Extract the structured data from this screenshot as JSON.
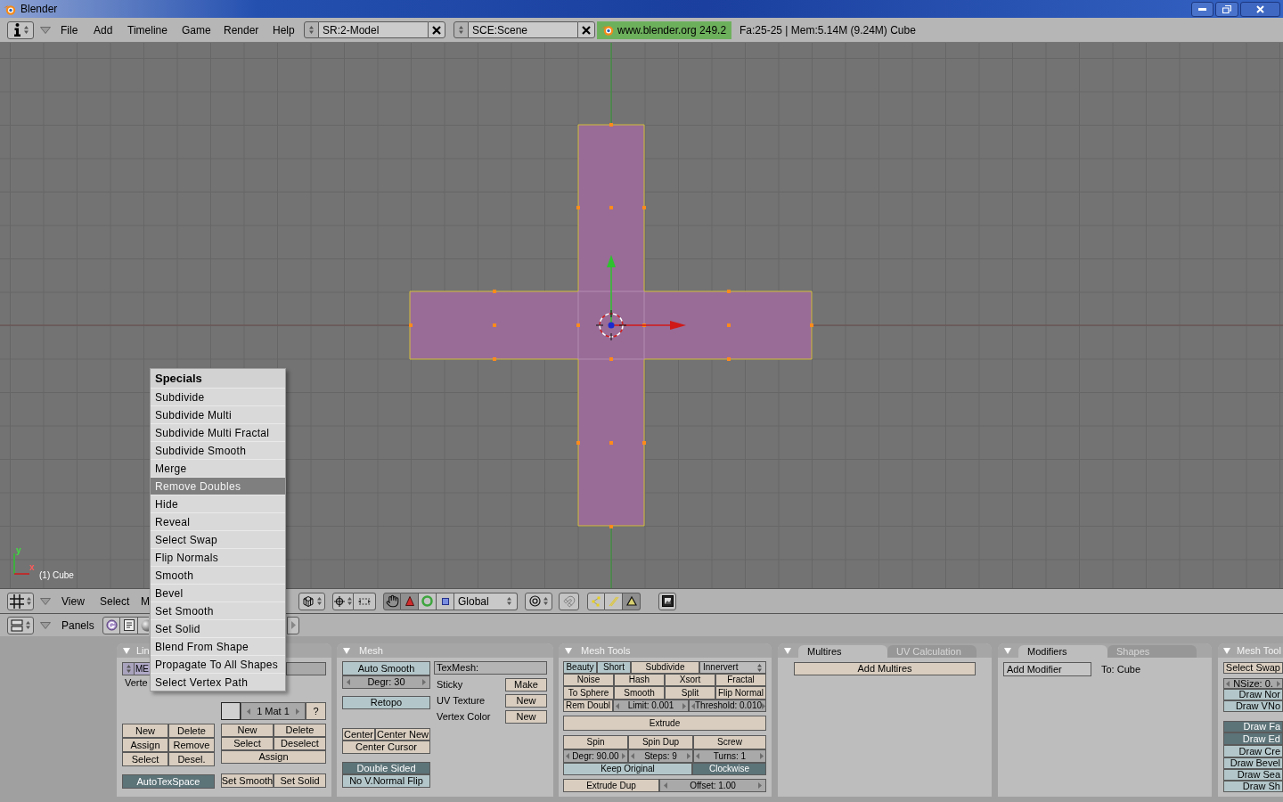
{
  "window": {
    "title": "Blender"
  },
  "info_header": {
    "menus": [
      "File",
      "Add",
      "Timeline",
      "Game",
      "Render",
      "Help"
    ],
    "screen_field": "SR:2-Model",
    "scene_field": "SCE:Scene",
    "version": "www.blender.org 249.2",
    "stats": "Fa:25-25 | Mem:5.14M (9.24M) Cube"
  },
  "viewport": {
    "axis_labels": [
      "y",
      "x"
    ],
    "object_label": "(1) Cube"
  },
  "viewport_header": {
    "menus": [
      "View",
      "Select",
      "M"
    ],
    "transform_widgets": [
      {
        "kind": "hand",
        "on": true
      },
      {
        "kind": "translate",
        "on": true
      },
      {
        "kind": "rotate",
        "on": false
      },
      {
        "kind": "scale",
        "on": false
      }
    ],
    "orientation": "Global",
    "select_modes": [
      {
        "kind": "vertex",
        "on": false
      },
      {
        "kind": "edge",
        "on": false
      },
      {
        "kind": "face",
        "on": true
      }
    ]
  },
  "buttons_header": {
    "label": "Panels"
  },
  "link_panel": {
    "title": "Lin",
    "name_field": "ME",
    "vertex_label": "Verte",
    "material_field": "1 Mat 1",
    "help_button": "?",
    "vertex_group_buttons": [
      "New",
      "Delete",
      "Assign",
      "Remove",
      "Select",
      "Desel."
    ],
    "material_buttons": [
      "New",
      "Delete",
      "Select",
      "Deselect",
      "Assign"
    ],
    "auto_tex_space": {
      "label": "AutoTexSpace",
      "on": true
    },
    "shading_buttons": [
      "Set Smooth",
      "Set Solid"
    ]
  },
  "mesh_panel": {
    "title": "Mesh",
    "auto_smooth": {
      "label": "Auto Smooth",
      "on": false
    },
    "degree": "Degr: 30",
    "retopo": {
      "label": "Retopo",
      "on": false
    },
    "center_buttons": [
      "Center",
      "Center New",
      "Center Cursor"
    ],
    "double_sided": {
      "label": "Double Sided",
      "on": true
    },
    "no_vnormal_flip": {
      "label": "No V.Normal Flip",
      "on": false
    },
    "texmesh_field": "TexMesh:",
    "layers": [
      {
        "label": "Sticky",
        "button": "Make"
      },
      {
        "label": "UV Texture",
        "button": "New"
      },
      {
        "label": "Vertex Color",
        "button": "New"
      }
    ]
  },
  "mesh_tools_panel": {
    "title": "Mesh Tools",
    "toggles": [
      {
        "label": "Beauty",
        "on": false
      },
      {
        "label": "Short",
        "on": false
      }
    ],
    "subdivide": "Subdivide",
    "subdivide_menu": "Innervert",
    "tool_buttons": [
      "Noise",
      "Hash",
      "Xsort",
      "Fractal",
      "To Sphere",
      "Smooth",
      "Split",
      "Flip Normal"
    ],
    "remove_doubles": "Rem Doubl",
    "limit": "Limit: 0.001",
    "threshold": "Threshold: 0.010",
    "extrude": "Extrude",
    "spin_buttons": [
      "Spin",
      "Spin Dup",
      "Screw"
    ],
    "spin_fields": [
      "Degr: 90.00",
      "Steps: 9",
      "Turns: 1"
    ],
    "keep_original": {
      "label": "Keep Original",
      "on": false
    },
    "clockwise": {
      "label": "Clockwise",
      "on": true
    },
    "extrude_dup": "Extrude Dup",
    "offset": "Offset: 1.00"
  },
  "multires_panel": {
    "tabs": [
      {
        "label": "Multires",
        "selected": true
      },
      {
        "label": "UV Calculation",
        "selected": false
      }
    ],
    "button": "Add Multires"
  },
  "modifiers_panel": {
    "tabs": [
      {
        "label": "Modifiers",
        "selected": true
      },
      {
        "label": "Shapes",
        "selected": false
      }
    ],
    "button": "Add Modifier",
    "target": "To: Cube"
  },
  "mesh_tools_more_panel": {
    "title": "Mesh Tool",
    "select_swap": "Select Swap",
    "normal_size": "NSize: 0.",
    "normal_toggles": [
      {
        "label": "Draw Nor",
        "on": false
      },
      {
        "label": "Draw VNo",
        "on": false
      }
    ],
    "draw_toggles": [
      {
        "label": "Draw Fa",
        "on": true
      },
      {
        "label": "Draw Ed",
        "on": true
      },
      {
        "label": "Draw Cre",
        "on": false
      },
      {
        "label": "Draw Bevel",
        "on": false
      },
      {
        "label": "Draw Sea",
        "on": false
      },
      {
        "label": "Draw Sh",
        "on": false
      }
    ]
  },
  "specials_menu": {
    "title": "Specials",
    "items": [
      {
        "label": "Subdivide",
        "selected": false
      },
      {
        "label": "Subdivide Multi",
        "selected": false
      },
      {
        "label": "Subdivide Multi Fractal",
        "selected": false
      },
      {
        "label": "Subdivide Smooth",
        "selected": false
      },
      {
        "label": "Merge",
        "selected": false
      },
      {
        "label": "Remove Doubles",
        "selected": true
      },
      {
        "label": "Hide",
        "selected": false
      },
      {
        "label": "Reveal",
        "selected": false
      },
      {
        "label": "Select Swap",
        "selected": false
      },
      {
        "label": "Flip Normals",
        "selected": false
      },
      {
        "label": "Smooth",
        "selected": false
      },
      {
        "label": "Bevel",
        "selected": false
      },
      {
        "label": "Set Smooth",
        "selected": false
      },
      {
        "label": "Set Solid",
        "selected": false
      },
      {
        "label": "Blend From Shape",
        "selected": false
      },
      {
        "label": "Propagate To All Shapes",
        "selected": false
      },
      {
        "label": "Select Vertex Path",
        "selected": false
      }
    ]
  }
}
